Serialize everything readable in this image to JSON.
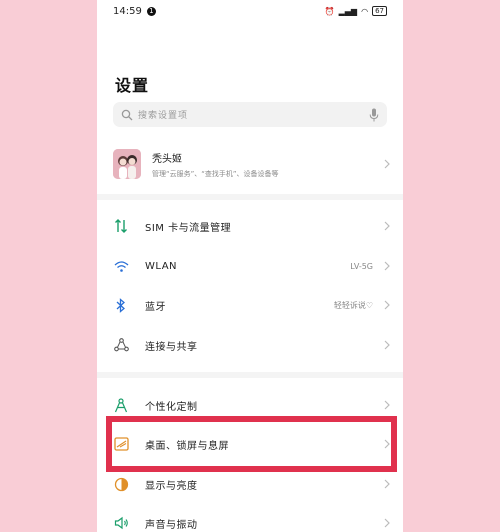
{
  "status": {
    "time": "14:59",
    "notif": "1",
    "icons": "⏰ ✱ ▮▮ ◠",
    "battery": "67"
  },
  "title": "设置",
  "search": {
    "placeholder": "搜索设置项"
  },
  "profile": {
    "name": "秃头姬",
    "subtitle": "管理“云服务”、“查找手机”、设备设备等"
  },
  "rows": [
    {
      "label": "SIM 卡与流量管理",
      "value": "",
      "icon": "sim-data-icon"
    },
    {
      "label": "WLAN",
      "value": "LV-5G",
      "icon": "wifi-icon"
    },
    {
      "label": "蓝牙",
      "value": "轻轻诉说♡",
      "icon": "bluetooth-icon"
    },
    {
      "label": "连接与共享",
      "value": "",
      "icon": "connection-share-icon"
    },
    {
      "label": "个性化定制",
      "value": "",
      "icon": "personalize-icon"
    },
    {
      "label": "桌面、锁屏与息屏",
      "value": "",
      "icon": "desktop-lockscreen-icon"
    },
    {
      "label": "显示与亮度",
      "value": "",
      "icon": "display-brightness-icon"
    },
    {
      "label": "声音与振动",
      "value": "",
      "icon": "sound-vibration-icon"
    }
  ],
  "colors": {
    "background": "#f9cdd6",
    "highlight": "#e0314d",
    "accent": "#1a9e6a"
  }
}
